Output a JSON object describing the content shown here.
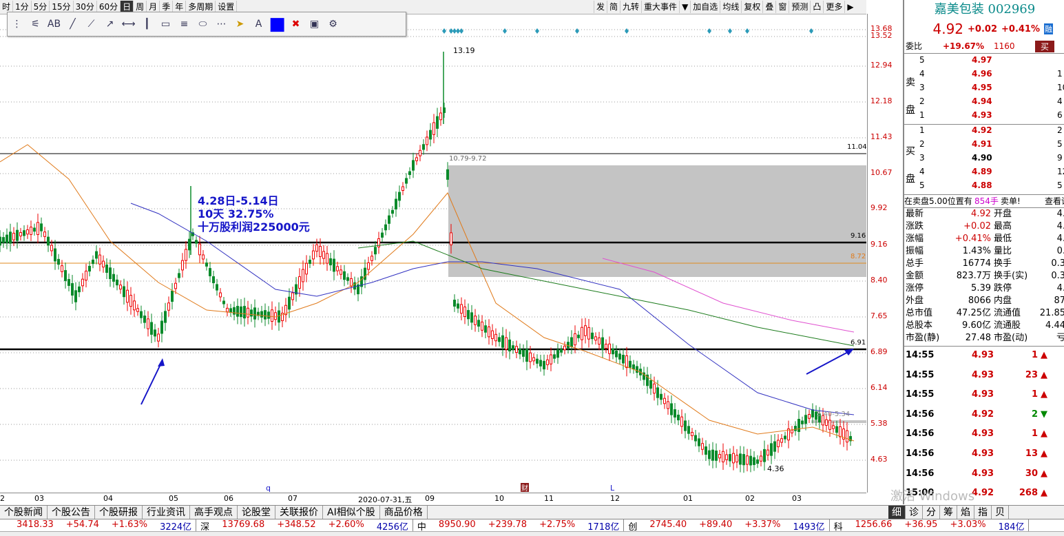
{
  "top_toolbar": {
    "timeframes": [
      "时",
      "1分",
      "5分",
      "15分",
      "30分",
      "60分",
      "日",
      "周",
      "月",
      "季",
      "年",
      "多周期",
      "设置"
    ],
    "active_index": 6,
    "right_items": [
      "发",
      "简",
      "九转",
      "重大事件",
      "▼",
      "加自选",
      "均线",
      "复权",
      "叠",
      "窗",
      "预测",
      "凸",
      "更多",
      "▶"
    ]
  },
  "draw_toolbar": {
    "icons": [
      "grip-icon",
      "settings-lines-icon",
      "text-ab-icon",
      "line-icon",
      "segment-icon",
      "ray-icon",
      "horizontal-segment-icon",
      "vertical-line-icon",
      "rectangle-icon",
      "parallel-lines-icon",
      "ellipse-icon",
      "more-icon",
      "cursor-icon",
      "text-icon",
      "color-swatch-icon",
      "delete-icon",
      "hide-icon",
      "gear-icon"
    ]
  },
  "annotation": {
    "line1": "4.28日-5.14日",
    "line2": "10天  32.75%",
    "line3": "十万股利润225000元"
  },
  "price_axis": [
    "13.68",
    "13.52",
    "12.94",
    "12.18",
    "11.43",
    "10.67",
    "9.92",
    "9.16",
    "8.40",
    "7.65",
    "6.89",
    "6.14",
    "5.38",
    "4.63"
  ],
  "chart_labels": {
    "high": "13.19",
    "low": "4.36",
    "level_1104": "11.04",
    "level_916": "9.16",
    "level_872": "8.72",
    "level_691": "6.91",
    "box_range": "10.79-9.72",
    "box_range2": "5.40-5.34",
    "marker_q": "q",
    "marker_L": "L",
    "marker_cai": "财"
  },
  "x_axis": [
    "2",
    "03",
    "04",
    "05",
    "06",
    "07",
    "2020-07-31,五",
    "09",
    "10",
    "11",
    "12",
    "01",
    "02",
    "03"
  ],
  "stock": {
    "name": "嘉美包装",
    "code": "002969",
    "price": "4.92",
    "change": "+0.02",
    "change_pct": "+0.41%",
    "tag": "融"
  },
  "weibi": {
    "label": "委比",
    "pct": "+19.67%",
    "diff": "1160",
    "btn": "买"
  },
  "sell": [
    {
      "lv": "5",
      "p": "4.97",
      "v": ""
    },
    {
      "lv": "4",
      "p": "4.96",
      "v": "1"
    },
    {
      "lv": "3",
      "p": "4.95",
      "v": "10"
    },
    {
      "lv": "2",
      "p": "4.94",
      "v": "4"
    },
    {
      "lv": "1",
      "p": "4.93",
      "v": "6"
    }
  ],
  "buy": [
    {
      "lv": "1",
      "p": "4.92",
      "v": "2"
    },
    {
      "lv": "2",
      "p": "4.91",
      "v": "5"
    },
    {
      "lv": "3",
      "p": "4.90",
      "v": "9"
    },
    {
      "lv": "4",
      "p": "4.89",
      "v": "12"
    },
    {
      "lv": "5",
      "p": "4.88",
      "v": "5"
    }
  ],
  "sell_label": "卖盘",
  "buy_label": "买盘",
  "notice": {
    "text": "在卖盘5.00位置有",
    "qty": "854手",
    "text2": "卖单!",
    "more": "查看详"
  },
  "stats": [
    [
      "最新",
      "4.92",
      "开盘",
      "4."
    ],
    [
      "涨跌",
      "+0.02",
      "最高",
      "4."
    ],
    [
      "涨幅",
      "+0.41%",
      "最低",
      "4."
    ],
    [
      "振幅",
      "1.43%",
      "量比",
      "0."
    ],
    [
      "总手",
      "16774",
      "换手",
      "0.3"
    ],
    [
      "金额",
      "823.7万",
      "换手(实)",
      "0.3"
    ],
    [
      "涨停",
      "5.39",
      "跌停",
      "4."
    ],
    [
      "外盘",
      "8066",
      "内盘",
      "87"
    ],
    [
      "总市值",
      "47.25亿",
      "流通值",
      "21.85"
    ],
    [
      "总股本",
      "9.60亿",
      "流通股",
      "4.44"
    ],
    [
      "市盈(静)",
      "27.48",
      "市盈(动)",
      "亏"
    ]
  ],
  "ticks": [
    {
      "t": "14:55",
      "p": "4.93",
      "v": "1",
      "d": "up"
    },
    {
      "t": "14:55",
      "p": "4.93",
      "v": "23",
      "d": "up"
    },
    {
      "t": "14:55",
      "p": "4.93",
      "v": "1",
      "d": "up"
    },
    {
      "t": "14:56",
      "p": "4.92",
      "v": "2",
      "d": "down"
    },
    {
      "t": "14:56",
      "p": "4.93",
      "v": "1",
      "d": "up"
    },
    {
      "t": "14:56",
      "p": "4.93",
      "v": "13",
      "d": "up"
    },
    {
      "t": "14:56",
      "p": "4.93",
      "v": "30",
      "d": "up"
    },
    {
      "t": "15:00",
      "p": "4.92",
      "v": "268",
      "d": "up"
    }
  ],
  "bottom_tabs": [
    "个股新闻",
    "个股公告",
    "个股研报",
    "行业资讯",
    "高手观点",
    "论股堂",
    "关联报价",
    "AI相似个股",
    "商品价格"
  ],
  "panel_tabs": [
    "细",
    "诊",
    "分",
    "筹",
    "焰",
    "指",
    "贝"
  ],
  "watermark": "激活 Windows",
  "index_bar": [
    {
      "name": "",
      "val": "3418.33",
      "chg": "+54.74",
      "pct": "+1.63%",
      "amt": "3224亿"
    },
    {
      "name": "深",
      "val": "13769.68",
      "chg": "+348.52",
      "pct": "+2.60%",
      "amt": "4256亿"
    },
    {
      "name": "中",
      "val": "8950.90",
      "chg": "+239.78",
      "pct": "+2.75%",
      "amt": "1718亿"
    },
    {
      "name": "创",
      "val": "2745.40",
      "chg": "+89.40",
      "pct": "+3.37%",
      "amt": "1493亿"
    },
    {
      "name": "科",
      "val": "1256.66",
      "chg": "+36.95",
      "pct": "+3.03%",
      "amt": "184亿"
    }
  ]
}
